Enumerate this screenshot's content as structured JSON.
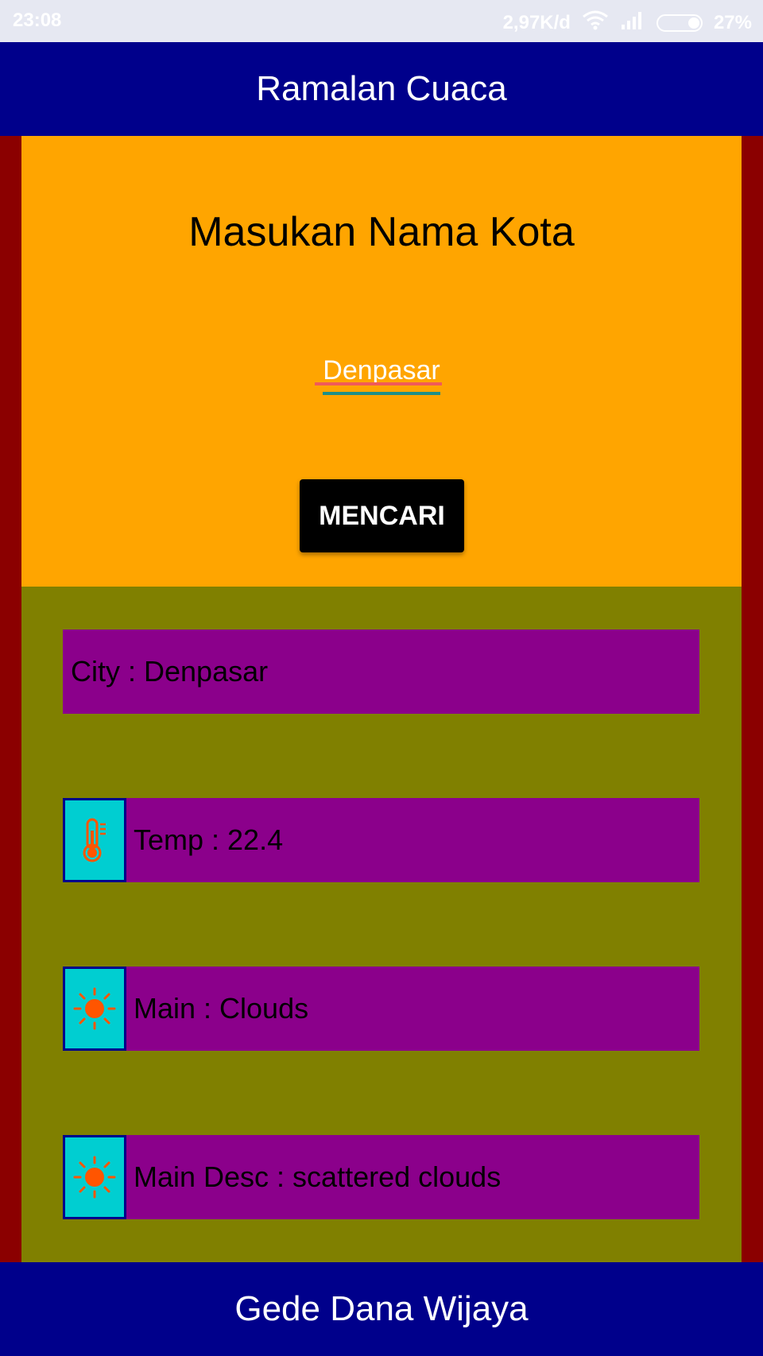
{
  "status_bar": {
    "time": "23:08",
    "network_speed": "2,97K/d",
    "battery_percent": "27%",
    "battery_level": 0.27,
    "icons": [
      "wifi-icon",
      "signal-icon",
      "battery-icon"
    ]
  },
  "header": {
    "title": "Ramalan Cuaca"
  },
  "search": {
    "prompt": "Masukan Nama Kota",
    "city_value": "Denpasar",
    "button_label": "MENCARI"
  },
  "results": {
    "city": "City : Denpasar",
    "temp": "Temp : 22.4",
    "main": "Main : Clouds",
    "main_desc": "Main Desc : scattered clouds",
    "icons": [
      "thermometer-icon",
      "sun-icon",
      "sun-icon"
    ]
  },
  "footer": {
    "author": "Gede Dana Wijaya"
  },
  "colors": {
    "header_bg": "#00008b",
    "search_panel_bg": "#ffa500",
    "result_panel_bg": "#808000",
    "row_bg": "#8b008b",
    "icon_box_bg": "#00ced1",
    "icon_color": "#ff5500",
    "frame_bg": "#8b0000",
    "button_bg": "#000000"
  }
}
